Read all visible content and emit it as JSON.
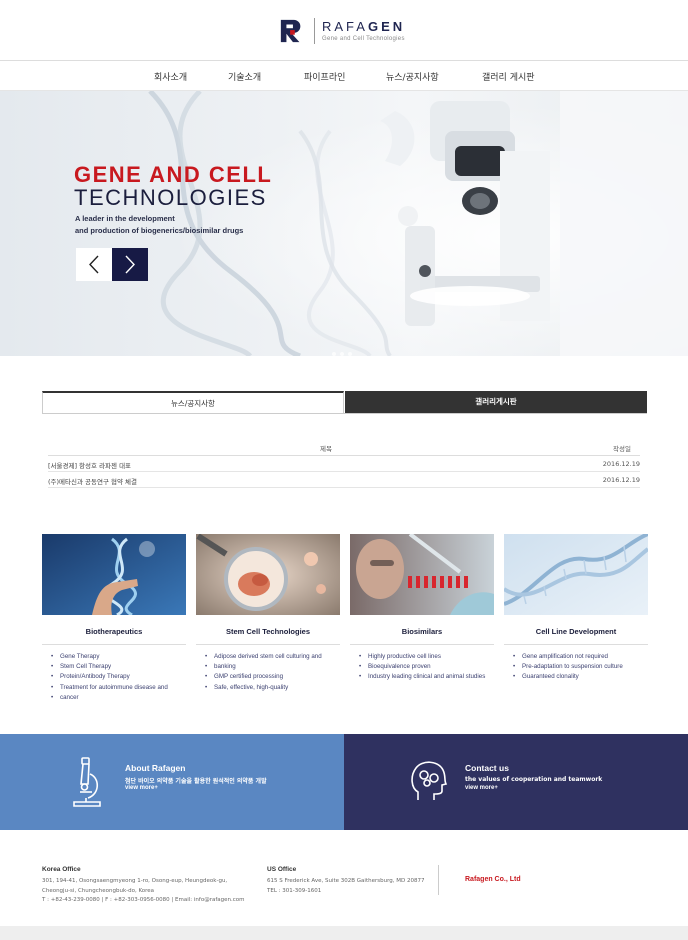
{
  "brand": {
    "name_light": "RAFA",
    "name_bold": "GEN",
    "tagline": "Gene and Cell Technologies",
    "mark_color": "#1f2550",
    "accent_color": "#c8191f"
  },
  "nav": {
    "items": [
      {
        "label": "회사소개"
      },
      {
        "label": "기술소개"
      },
      {
        "label": "파이프라인"
      },
      {
        "label": "뉴스/공지사항"
      },
      {
        "label": "갤러리 게시판"
      }
    ]
  },
  "hero": {
    "title_line1": "GENE AND CELL",
    "title_line2": "TECHNOLOGIES",
    "subtitle_line1": "A leader in the development",
    "subtitle_line2": "and production of biogenerics/biosimilar drugs",
    "prev_icon": "chevron-left-icon",
    "next_icon": "chevron-right-icon"
  },
  "tabs": {
    "news_label": "뉴스/공지사항",
    "gallery_label": "갤러리게시판"
  },
  "board": {
    "col_title": "제목",
    "col_date": "작성일",
    "rows": [
      {
        "title": "[서울경제] 항성호 라파젠 대표",
        "date": "2016.12.19"
      },
      {
        "title": "(주)메타신과 공동연구 협약 체결",
        "date": "2016.12.19"
      }
    ]
  },
  "cards": [
    {
      "title": "Biotherapeutics",
      "items": [
        "Gene Therapy",
        "Stem Cell Therapy",
        "Protein/Antibody Therapy",
        "Treatment for autoimmune disease and",
        "cancer"
      ]
    },
    {
      "title": "Stem Cell Technologies",
      "items": [
        "Adipose derived stem cell culturing and",
        "banking",
        "GMP certified processing",
        "Safe, effective, high-quality"
      ]
    },
    {
      "title": "Biosimilars",
      "items": [
        "Highly productive cell lines",
        "Bioequivalence proven",
        "Industry leading clinical and animal studies"
      ]
    },
    {
      "title": "Cell Line Development",
      "items": [
        "Gene amplification not required",
        "Pre-adaptation to suspension culture",
        "Guaranteed clonality"
      ]
    }
  ],
  "banners": {
    "about": {
      "title": "About Rafagen",
      "desc": "첨단 바이오 의약품 기술을 활용한 원석적인 의약품 개발",
      "more": "view more+",
      "icon": "microscope-icon",
      "color": "#5a87c2"
    },
    "contact": {
      "title": "Contact us",
      "desc": "the values of cooperation and teamwork",
      "more": "view more+",
      "icon": "head-gears-icon",
      "color": "#2f3160"
    }
  },
  "footer": {
    "korea": {
      "title": "Korea Office",
      "line1": "301, 194-41, Osongsaengmyeong 1-ro, Osong-eup, Heungdeok-gu,",
      "line2": "Cheongju-si, Chungcheongbuk-do, Korea",
      "line3": "T : +82-43-239-0080 | F : +82-303-0956-0080 | Email: info@rafagen.com"
    },
    "us": {
      "title": "US Office",
      "line1": "615 S Frederick Ave, Suite 302B Gaithersburg, MD 20877",
      "line2": "TEL : 301-309-1601"
    },
    "company": "Rafagen Co., Ltd"
  }
}
